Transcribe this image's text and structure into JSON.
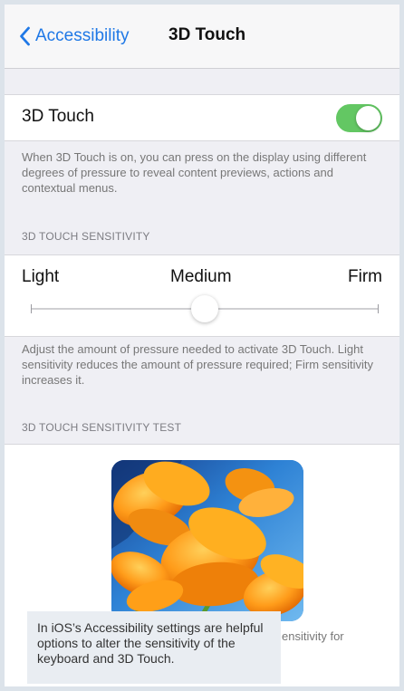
{
  "nav": {
    "back_label": "Accessibility",
    "title": "3D Touch"
  },
  "touch_setting": {
    "label": "3D Touch",
    "enabled": true,
    "description": "When 3D Touch is on, you can press on the display using different degrees of pressure to reveal content previews, actions and contextual menus."
  },
  "sensitivity": {
    "header": "3D TOUCH SENSITIVITY",
    "labels": {
      "light": "Light",
      "medium": "Medium",
      "firm": "Firm"
    },
    "selected": "Medium",
    "description": "Adjust the amount of pressure needed to activate 3D Touch. Light sensitivity reduces the amount of pressure required; Firm sensitivity increases it."
  },
  "test_section": {
    "header": "3D TOUCH SENSITIVITY TEST",
    "partial_text": "ensitivity for"
  },
  "caption": {
    "text": "In iOS’s Accessibility settings are helpful options to alter the sensitivity of the keyboard and 3D Touch."
  },
  "colors": {
    "accent": "#1f78e6",
    "switch_on": "#63c763",
    "background": "#efeff4"
  },
  "icons": {
    "back": "chevron-left-icon"
  }
}
